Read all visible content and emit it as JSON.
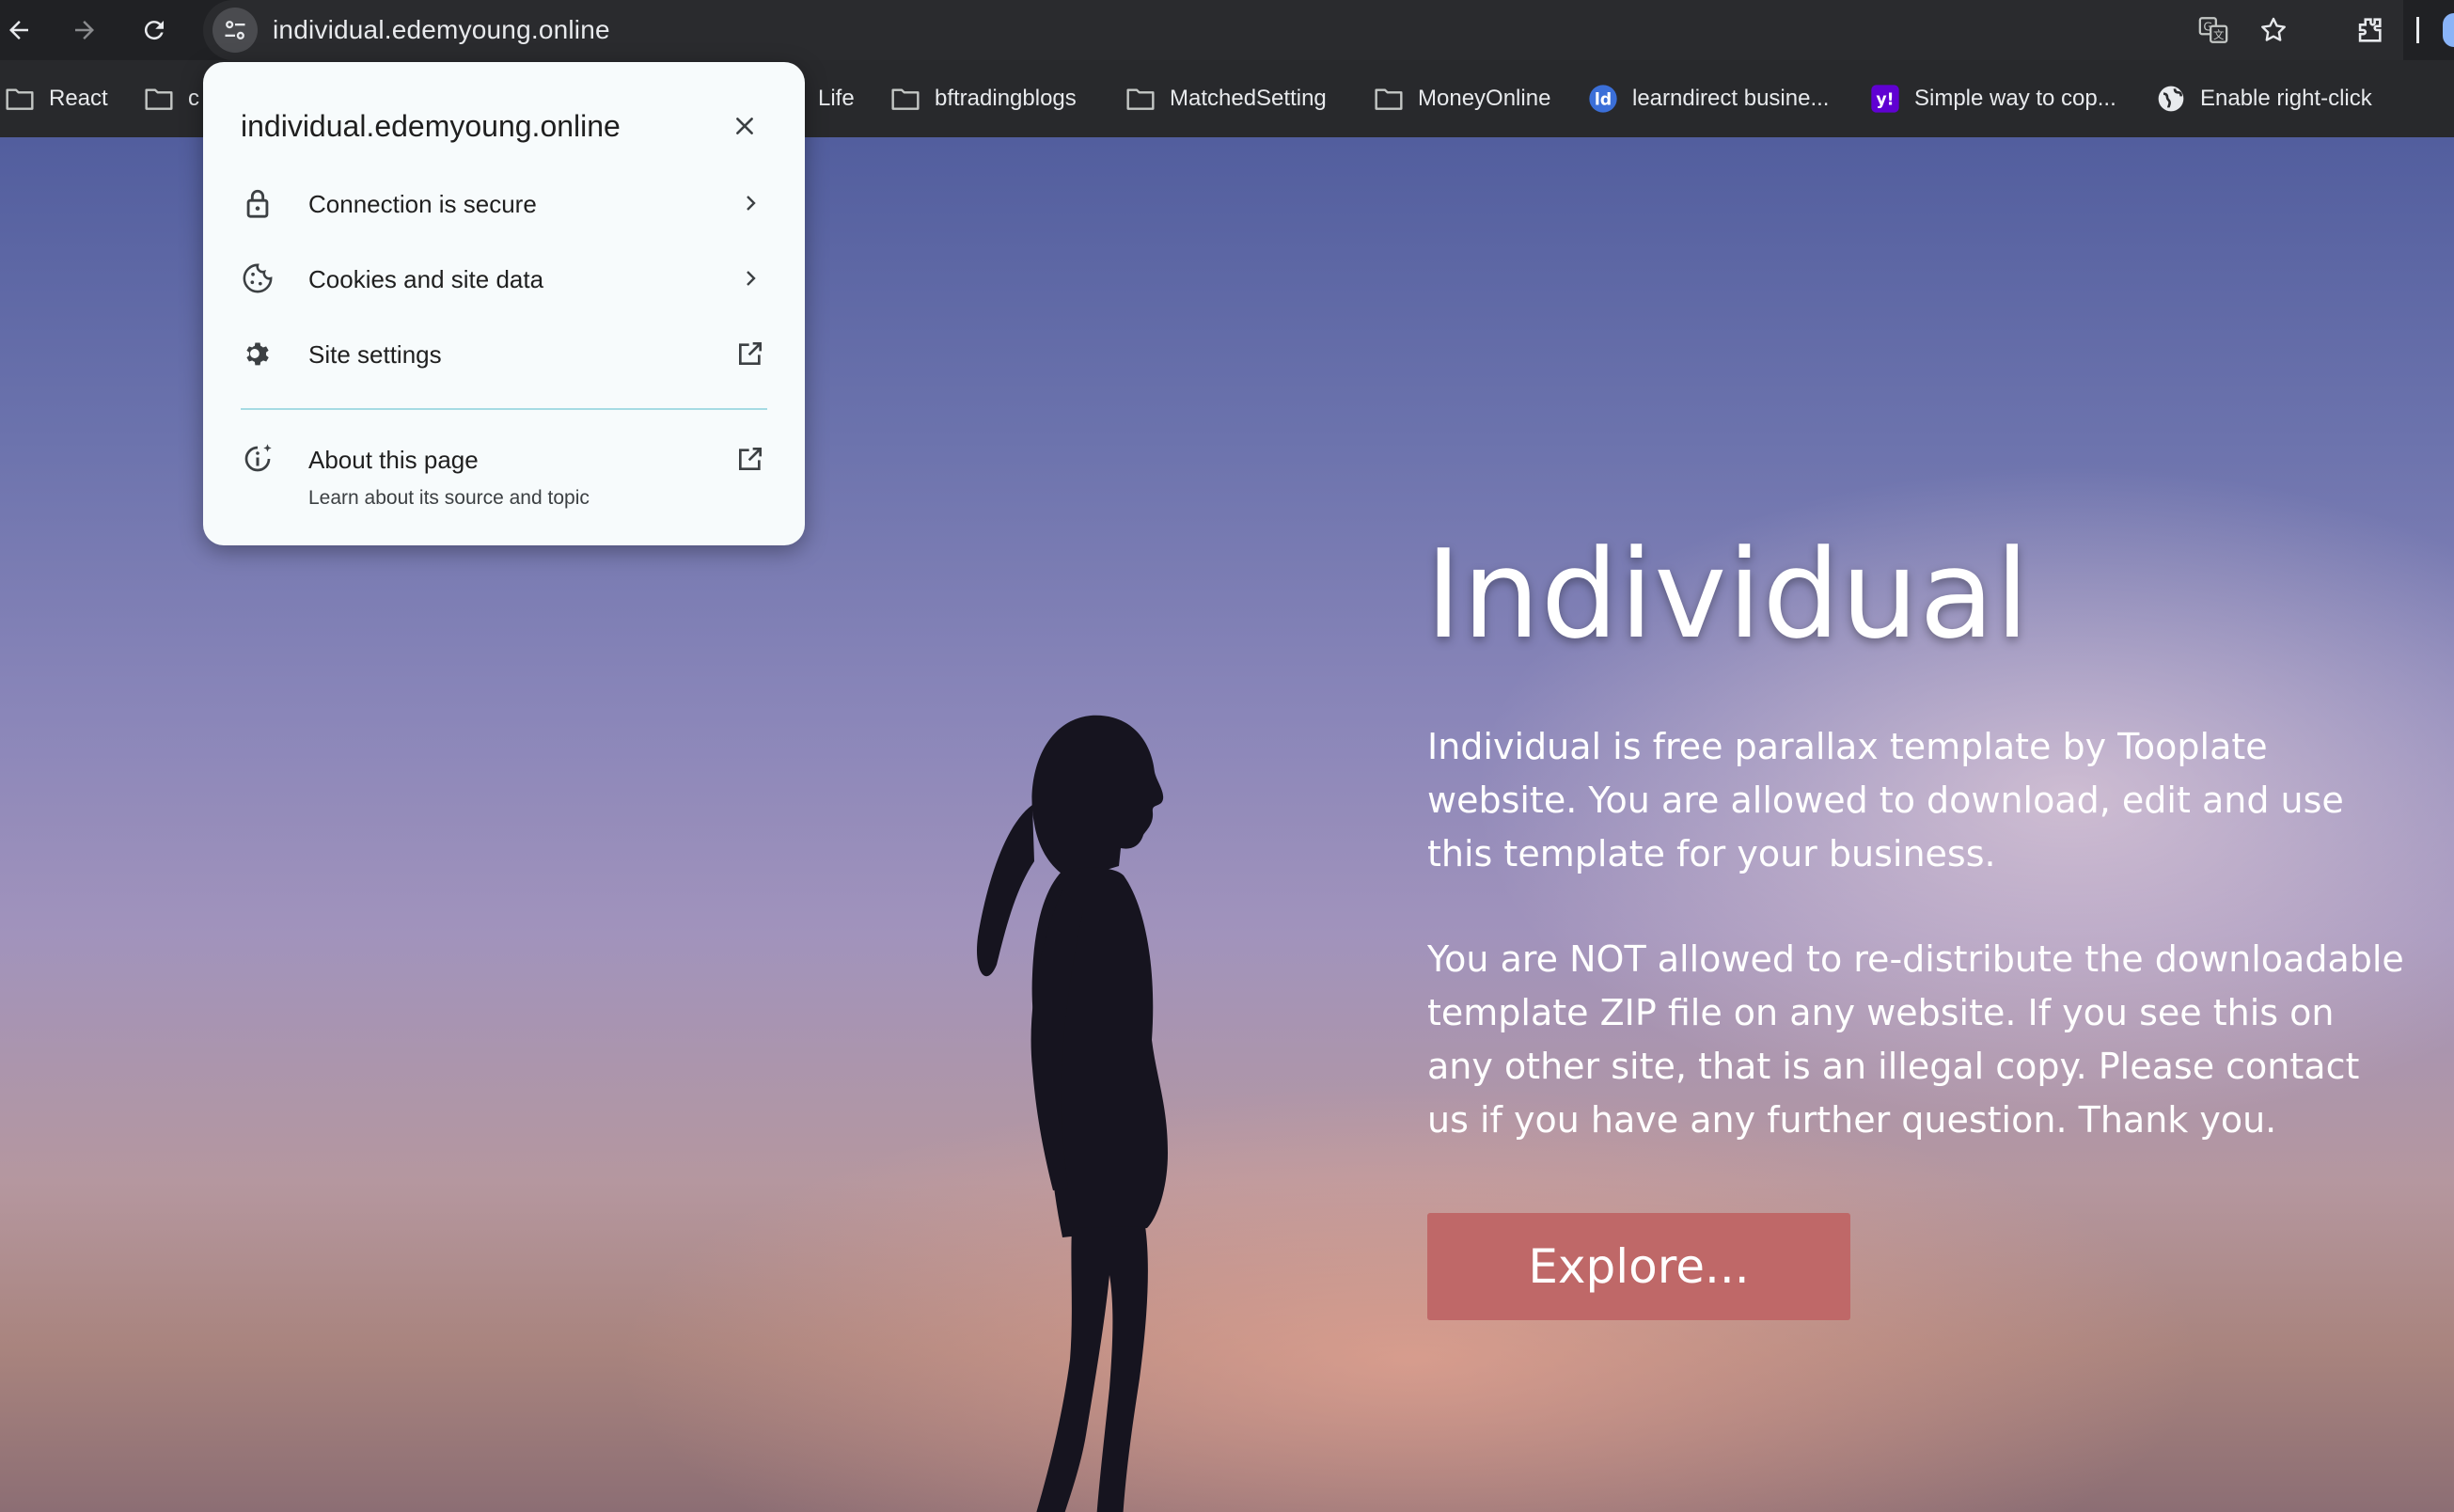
{
  "browser": {
    "url": "individual.edemyoung.online",
    "bookmarks": [
      {
        "label": "React",
        "icon": "folder-icon"
      },
      {
        "label": "c",
        "icon": "folder-icon"
      },
      {
        "label": "Life",
        "icon": "folder-icon"
      },
      {
        "label": "bftradingblogs",
        "icon": "folder-icon"
      },
      {
        "label": "MatchedSetting",
        "icon": "folder-icon"
      },
      {
        "label": "MoneyOnline",
        "icon": "folder-icon"
      },
      {
        "label": "learndirect busine...",
        "icon": "learndirect-icon"
      },
      {
        "label": "Simple way to cop...",
        "icon": "yahoo-icon"
      },
      {
        "label": "Enable right-click",
        "icon": "globe-icon"
      }
    ]
  },
  "site_info_popup": {
    "title": "individual.edemyoung.online",
    "items": [
      {
        "label": "Connection is secure",
        "icon": "lock-icon",
        "trailing": "chevron-right-icon"
      },
      {
        "label": "Cookies and site data",
        "icon": "cookie-icon",
        "trailing": "chevron-right-icon"
      },
      {
        "label": "Site settings",
        "icon": "gear-icon",
        "trailing": "open-external-icon"
      }
    ],
    "about": {
      "label": "About this page",
      "sublabel": "Learn about its source and topic",
      "icon": "info-sparkle-icon",
      "trailing": "open-external-icon"
    }
  },
  "hero": {
    "title": "Individual",
    "paragraph1": "Individual is free parallax template by Tooplate website. You are allowed to download, edit and use this template for your business.",
    "paragraph2": "You are NOT allowed to re-distribute the downloadable template ZIP file on any website. If you see this on any other site, that is an illegal copy. Please contact us if you have any further question. Thank you.",
    "button_label": "Explore..."
  },
  "colors": {
    "toolbar_bg": "#202124",
    "bookmarks_bg": "#28292c",
    "popup_bg": "#f7fbfc",
    "explore_button": "#bf6868",
    "sky_top": "#525e9e",
    "sky_bottom": "#a9847e"
  }
}
